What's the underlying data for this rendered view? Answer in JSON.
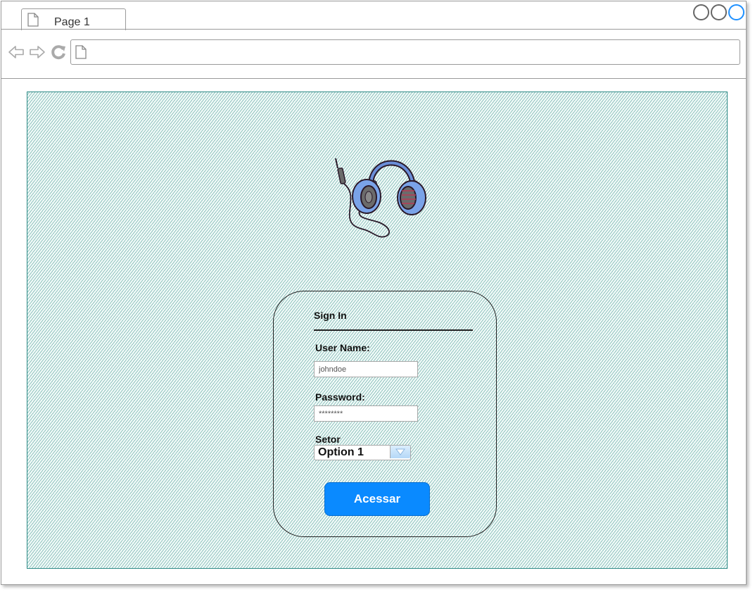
{
  "browser": {
    "tab_title": "Page 1",
    "address_value": "",
    "icons": {
      "tab": "page-icon",
      "back": "back-arrow-icon",
      "forward": "forward-arrow-icon",
      "reload": "reload-icon",
      "address": "page-icon",
      "window_controls": [
        "circle-icon",
        "circle-icon",
        "circle-icon"
      ]
    }
  },
  "login": {
    "logo_icon": "headset-icon",
    "title": "Sign In",
    "username_label": "User Name:",
    "username_value": "johndoe",
    "password_label": "Password:",
    "password_value": "********",
    "sector_label": "Setor",
    "sector_selected": "Option 1",
    "submit_label": "Acessar"
  },
  "colors": {
    "accent": "#0a8aff",
    "hatch": "#3e968c",
    "active_window_control": "#1e90ff"
  }
}
